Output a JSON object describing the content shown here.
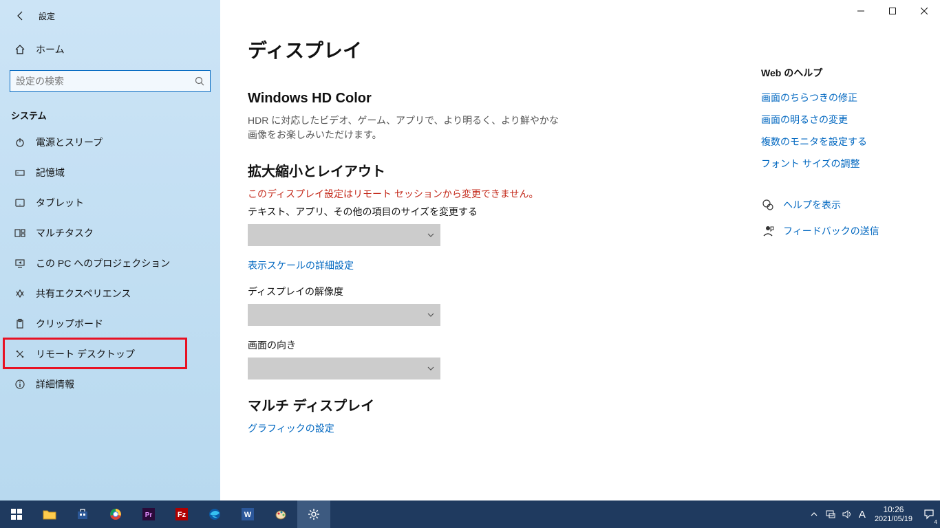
{
  "titlebar": {
    "title": "設定"
  },
  "sidebar": {
    "home_label": "ホーム",
    "search_placeholder": "設定の検索",
    "section_label": "システム",
    "items": [
      {
        "icon": "power-icon",
        "label": "電源とスリープ"
      },
      {
        "icon": "storage-icon",
        "label": "記憶域"
      },
      {
        "icon": "tablet-icon",
        "label": "タブレット"
      },
      {
        "icon": "multitask-icon",
        "label": "マルチタスク"
      },
      {
        "icon": "projection-icon",
        "label": "この PC へのプロジェクション"
      },
      {
        "icon": "shared-icon",
        "label": "共有エクスペリエンス"
      },
      {
        "icon": "clipboard-icon",
        "label": "クリップボード"
      },
      {
        "icon": "remote-icon",
        "label": "リモート デスクトップ"
      },
      {
        "icon": "info-icon",
        "label": "詳細情報"
      }
    ],
    "highlighted_index": 7
  },
  "main": {
    "page_title": "ディスプレイ",
    "hd_title": "Windows HD Color",
    "hd_desc": "HDR に対応したビデオ、ゲーム、アプリで、より明るく、より鮮やかな画像をお楽しみいただけます。",
    "scale_title": "拡大縮小とレイアウト",
    "remote_warning": "このディスプレイ設定はリモート セッションから変更できません。",
    "scale_label": "テキスト、アプリ、その他の項目のサイズを変更する",
    "advanced_scale_link": "表示スケールの詳細設定",
    "resolution_label": "ディスプレイの解像度",
    "orientation_label": "画面の向き",
    "multi_title": "マルチ ディスプレイ",
    "graphics_link": "グラフィックの設定"
  },
  "rightcol": {
    "web_help_title": "Web のヘルプ",
    "links": [
      "画面のちらつきの修正",
      "画面の明るさの変更",
      "複数のモニタを設定する",
      "フォント サイズの調整"
    ],
    "help_label": "ヘルプを表示",
    "feedback_label": "フィードバックの送信"
  },
  "taskbar": {
    "time": "10:26",
    "date": "2021/05/19",
    "ime": "A",
    "notification_badge": "4"
  }
}
